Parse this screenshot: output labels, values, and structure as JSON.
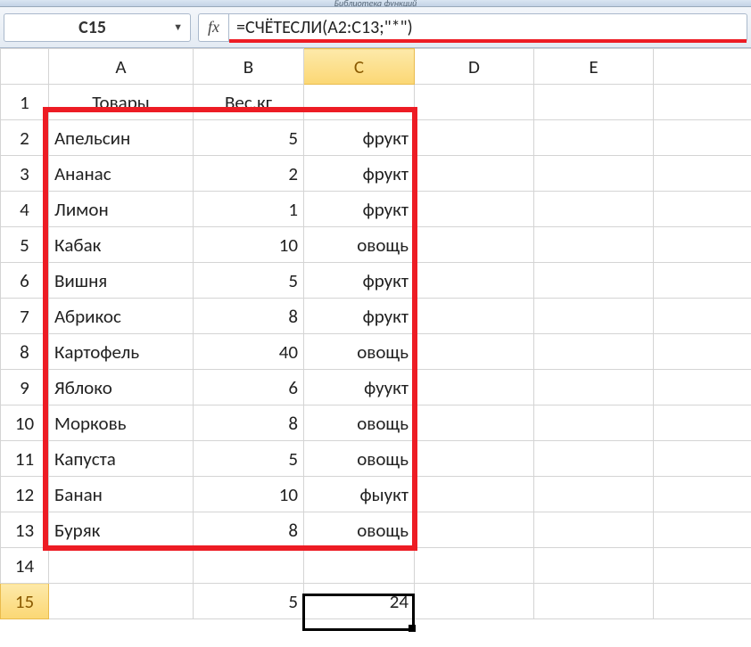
{
  "ribbon_hint": "Библиотека функций",
  "name_box": "C15",
  "fx_label": "fx",
  "formula": "=СЧЁТЕСЛИ(A2:C13;\"*\")",
  "columns": [
    "A",
    "B",
    "C",
    "D",
    "E"
  ],
  "rows": [
    {
      "n": "1",
      "A": "Товары",
      "B": "Вес.кг",
      "C": ""
    },
    {
      "n": "2",
      "A": "Апельсин",
      "B": "5",
      "C": "фрукт"
    },
    {
      "n": "3",
      "A": "Ананас",
      "B": "2",
      "C": "фрукт"
    },
    {
      "n": "4",
      "A": "Лимон",
      "B": "1",
      "C": "фрукт"
    },
    {
      "n": "5",
      "A": "Кабак",
      "B": "10",
      "C": "овощь"
    },
    {
      "n": "6",
      "A": "Вишня",
      "B": "5",
      "C": "фрукт"
    },
    {
      "n": "7",
      "A": "Абрикос",
      "B": "8",
      "C": "фрукт"
    },
    {
      "n": "8",
      "A": "Картофель",
      "B": "40",
      "C": "овощь"
    },
    {
      "n": "9",
      "A": "Яблоко",
      "B": "6",
      "C": "фуукт"
    },
    {
      "n": "10",
      "A": "Морковь",
      "B": "8",
      "C": "овощь"
    },
    {
      "n": "11",
      "A": "Капуста",
      "B": "5",
      "C": "овощь"
    },
    {
      "n": "12",
      "A": "Банан",
      "B": "10",
      "C": "фыукт"
    },
    {
      "n": "13",
      "A": "Буряк",
      "B": "8",
      "C": "овощь"
    },
    {
      "n": "14",
      "A": "",
      "B": "",
      "C": ""
    },
    {
      "n": "15",
      "A": "",
      "B": "5",
      "C": "24"
    }
  ]
}
